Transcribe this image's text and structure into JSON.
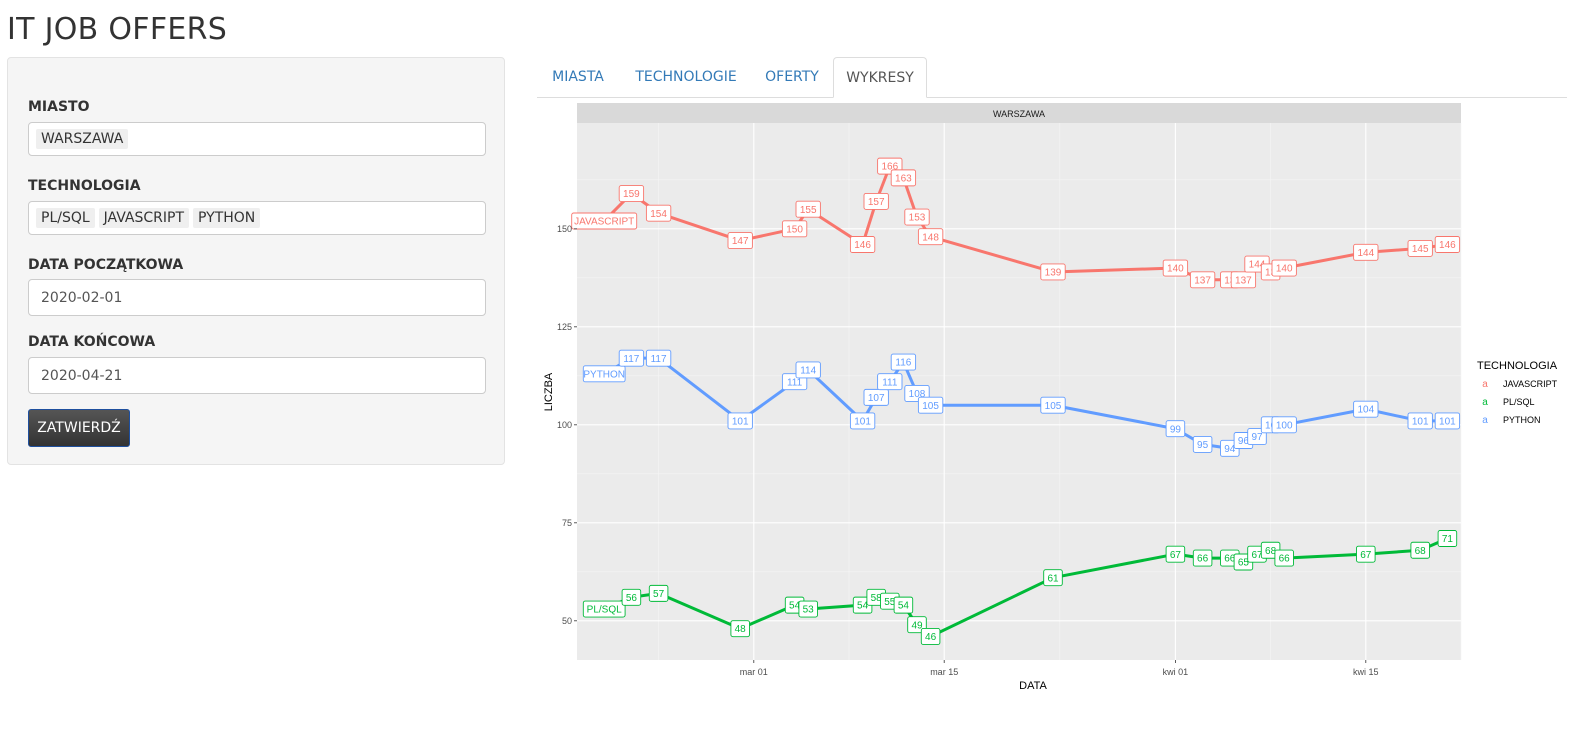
{
  "app": {
    "title": "IT JOB OFFERS"
  },
  "sidebar": {
    "city_label": "MIASTO",
    "city_values": [
      "WARSZAWA"
    ],
    "tech_label": "TECHNOLOGIA",
    "tech_values": [
      "PL/SQL",
      "JAVASCRIPT",
      "PYTHON"
    ],
    "start_label": "DATA POCZĄTKOWA",
    "start_value": "2020-02-01",
    "end_label": "DATA KOŃCOWA",
    "end_value": "2020-04-21",
    "submit_label": "ZATWIERDŹ"
  },
  "tabs": [
    {
      "label": "MIASTA",
      "active": false
    },
    {
      "label": "TECHNOLOGIE",
      "active": false
    },
    {
      "label": "OFERTY",
      "active": false
    },
    {
      "label": "WYKRESY",
      "active": true
    }
  ],
  "chart_data": {
    "type": "line",
    "title": "",
    "facet_label": "WARSZAWA",
    "xlabel": "DATA",
    "ylabel": "LICZBA",
    "x_ticks": [
      {
        "date": "2020-03-01",
        "label": "mar 01"
      },
      {
        "date": "2020-03-15",
        "label": "mar 15"
      },
      {
        "date": "2020-04-01",
        "label": "kwi 01"
      },
      {
        "date": "2020-04-15",
        "label": "kwi 15"
      }
    ],
    "xlim": [
      "2020-02-17",
      "2020-04-22"
    ],
    "y_ticks": [
      50,
      75,
      100,
      125,
      150
    ],
    "ylim": [
      40,
      177
    ],
    "grid": true,
    "legend_title": "TECHNOLOGIA",
    "legend_position": "right",
    "series": [
      {
        "name": "JAVASCRIPT",
        "color": "#F8766D",
        "x": [
          "2020-02-19",
          "2020-02-21",
          "2020-02-23",
          "2020-02-29",
          "2020-03-04",
          "2020-03-05",
          "2020-03-09",
          "2020-03-10",
          "2020-03-11",
          "2020-03-12",
          "2020-03-13",
          "2020-03-14",
          "2020-03-23",
          "2020-04-01",
          "2020-04-03",
          "2020-04-05",
          "2020-04-06",
          "2020-04-07",
          "2020-04-08",
          "2020-04-09",
          "2020-04-15",
          "2020-04-19",
          "2020-04-21"
        ],
        "y": [
          152,
          159,
          154,
          147,
          150,
          155,
          146,
          157,
          166,
          163,
          153,
          148,
          139,
          140,
          137,
          137,
          137,
          141,
          139,
          140,
          144,
          145,
          146
        ],
        "labels": [
          "JAVASCRIPT",
          "159",
          "154",
          "147",
          "150",
          "155",
          "146",
          "157",
          "166",
          "163",
          "153",
          "148",
          "139",
          "140",
          "137",
          "13",
          "137",
          "144",
          "13",
          "140",
          "144",
          "145",
          "146"
        ]
      },
      {
        "name": "PYTHON",
        "color": "#619CFF",
        "x": [
          "2020-02-19",
          "2020-02-21",
          "2020-02-23",
          "2020-02-29",
          "2020-03-04",
          "2020-03-05",
          "2020-03-09",
          "2020-03-10",
          "2020-03-11",
          "2020-03-12",
          "2020-03-13",
          "2020-03-14",
          "2020-03-23",
          "2020-04-01",
          "2020-04-03",
          "2020-04-05",
          "2020-04-06",
          "2020-04-07",
          "2020-04-08",
          "2020-04-09",
          "2020-04-15",
          "2020-04-19",
          "2020-04-21"
        ],
        "y": [
          113,
          117,
          117,
          101,
          111,
          114,
          101,
          107,
          111,
          116,
          108,
          105,
          105,
          99,
          95,
          94,
          96,
          97,
          100,
          100,
          104,
          101,
          101
        ],
        "labels": [
          "PYTHON",
          "117",
          "117",
          "101",
          "111",
          "114",
          "101",
          "107",
          "111",
          "116",
          "108",
          "105",
          "105",
          "99",
          "95",
          "94",
          "96",
          "97",
          "10",
          "100",
          "104",
          "101",
          "101"
        ]
      },
      {
        "name": "PL/SQL",
        "color": "#00BA38",
        "x": [
          "2020-02-19",
          "2020-02-21",
          "2020-02-23",
          "2020-02-29",
          "2020-03-04",
          "2020-03-05",
          "2020-03-09",
          "2020-03-10",
          "2020-03-11",
          "2020-03-12",
          "2020-03-13",
          "2020-03-14",
          "2020-03-23",
          "2020-04-01",
          "2020-04-03",
          "2020-04-05",
          "2020-04-06",
          "2020-04-07",
          "2020-04-08",
          "2020-04-09",
          "2020-04-15",
          "2020-04-19",
          "2020-04-21"
        ],
        "y": [
          53,
          56,
          57,
          48,
          54,
          53,
          54,
          56,
          55,
          54,
          49,
          46,
          61,
          67,
          66,
          66,
          65,
          67,
          68,
          66,
          67,
          68,
          71
        ],
        "labels": [
          "PL/SQL",
          "56",
          "57",
          "48",
          "54",
          "53",
          "54",
          "58",
          "55",
          "54",
          "49",
          "46",
          "61",
          "67",
          "66",
          "66",
          "65",
          "67",
          "68",
          "66",
          "67",
          "68",
          "71"
        ]
      }
    ],
    "legend_order": [
      "JAVASCRIPT",
      "PL/SQL",
      "PYTHON"
    ]
  }
}
